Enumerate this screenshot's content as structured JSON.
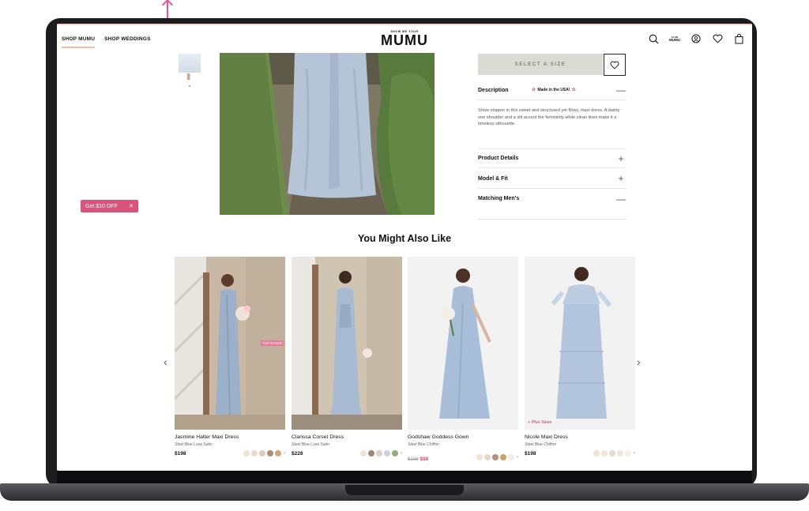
{
  "header": {
    "nav": [
      "SHOP MUMU",
      "SHOP WEDDINGS"
    ],
    "logo_small": "SHOW ME YOUR",
    "logo": "MUMU",
    "club_small": "CLUB",
    "club_label": "MUMU"
  },
  "product": {
    "select_size": "SELECT A SIZE",
    "description_label": "Description",
    "made_in_usa": "Made in the USA!",
    "description_text": "Show stopper in this sweet and structured yet flowy, maxi dress. A dainty one shoulder and a slit accent the femininity while clean lines make it a timeless silhouette.",
    "accordions": [
      {
        "label": "Product Details",
        "toggle": "+"
      },
      {
        "label": "Model & Fit",
        "toggle": "+"
      },
      {
        "label": "Matching Men's",
        "toggle": "—"
      }
    ],
    "description_toggle": "—"
  },
  "promo": {
    "label": "Get $10 OFF",
    "close": "✕"
  },
  "recommendations": {
    "title": "You Might Also Like",
    "prev": "‹",
    "next": "›",
    "items": [
      {
        "name": "Jasmine Halter Maxi Dress",
        "color": "Steel Blue Luxe Satin",
        "price": "$198",
        "badge": "TOP RATED",
        "swatches": [
          "#efe3d3",
          "#e9dccd",
          "#d9ccc0",
          "#b08b76",
          "#cfa879"
        ]
      },
      {
        "name": "Clarissa Corset Dress",
        "color": "Steel Blue Luxe Satin",
        "price": "$228",
        "swatches": [
          "#efe3d3",
          "#a6847c",
          "#d8d2cc",
          "#cdd0dd",
          "#98ab7c"
        ]
      },
      {
        "name": "Godshaw Goddess Gown",
        "color": "Steel Blue Chiffon",
        "old_price": "$198",
        "price": "$98",
        "swatches": [
          "#efe3d3",
          "#e7d7c6",
          "#b3927c",
          "#caa26a",
          "#f1ede5"
        ]
      },
      {
        "name": "Nicole Maxi Dress",
        "color": "Steel Blue Chiffon",
        "price": "$198",
        "badge": "+ Plus Sizes",
        "swatches": [
          "#efe3d3",
          "#eee6da",
          "#e6dccc",
          "#efe8da",
          "#f5f1e7"
        ]
      }
    ],
    "more": "›"
  }
}
